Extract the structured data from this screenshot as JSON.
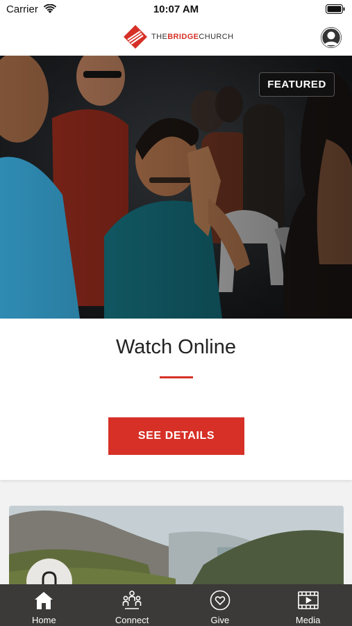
{
  "status_bar": {
    "carrier": "Carrier",
    "time": "10:07 AM"
  },
  "header": {
    "logo_prefix": "THE",
    "logo_bold": "BRIDGE",
    "logo_suffix": "CHURCH",
    "brand_color": "#d63027"
  },
  "featured": {
    "badge": "FEATURED",
    "title": "Watch Online",
    "button_label": "SEE DETAILS"
  },
  "tabs": [
    {
      "label": "Home",
      "icon": "home-icon"
    },
    {
      "label": "Connect",
      "icon": "people-icon"
    },
    {
      "label": "Give",
      "icon": "heart-icon"
    },
    {
      "label": "Media",
      "icon": "film-icon"
    }
  ]
}
